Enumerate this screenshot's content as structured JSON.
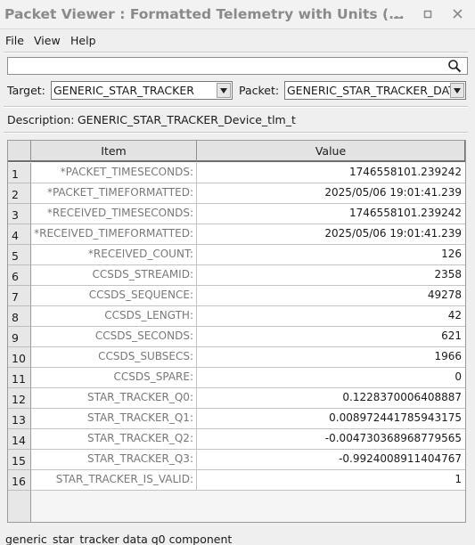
{
  "window": {
    "title": "Packet Viewer : Formatted Telemetry with Units (...",
    "minimize_glyph": "−",
    "maximize_glyph": "□",
    "close_glyph": "✕"
  },
  "menu": {
    "file": "File",
    "view": "View",
    "help": "Help"
  },
  "search": {
    "value": "",
    "icon": "search-icon"
  },
  "target": {
    "label": "Target:",
    "value": "GENERIC_STAR_TRACKER"
  },
  "packet": {
    "label": "Packet:",
    "value": "GENERIC_STAR_TRACKER_DATA"
  },
  "description": {
    "label": "Description:",
    "value": "GENERIC_STAR_TRACKER_Device_tlm_t"
  },
  "table": {
    "headers": {
      "item": "Item",
      "value": "Value"
    },
    "rows": [
      {
        "num": "1",
        "item": "*PACKET_TIMESECONDS:",
        "value": "1746558101.239242"
      },
      {
        "num": "2",
        "item": "*PACKET_TIMEFORMATTED:",
        "value": "2025/05/06 19:01:41.239"
      },
      {
        "num": "3",
        "item": "*RECEIVED_TIMESECONDS:",
        "value": "1746558101.239242"
      },
      {
        "num": "4",
        "item": "*RECEIVED_TIMEFORMATTED:",
        "value": "2025/05/06 19:01:41.239"
      },
      {
        "num": "5",
        "item": "*RECEIVED_COUNT:",
        "value": "126"
      },
      {
        "num": "6",
        "item": "CCSDS_STREAMID:",
        "value": "2358"
      },
      {
        "num": "7",
        "item": "CCSDS_SEQUENCE:",
        "value": "49278"
      },
      {
        "num": "8",
        "item": "CCSDS_LENGTH:",
        "value": "42"
      },
      {
        "num": "9",
        "item": "CCSDS_SECONDS:",
        "value": "621"
      },
      {
        "num": "10",
        "item": "CCSDS_SUBSECS:",
        "value": "1966"
      },
      {
        "num": "11",
        "item": "CCSDS_SPARE:",
        "value": "0"
      },
      {
        "num": "12",
        "item": "STAR_TRACKER_Q0:",
        "value": "0.1228370006408887"
      },
      {
        "num": "13",
        "item": "STAR_TRACKER_Q1:",
        "value": "0.008972441785943175"
      },
      {
        "num": "14",
        "item": "STAR_TRACKER_Q2:",
        "value": "-0.004730368968779565"
      },
      {
        "num": "15",
        "item": "STAR_TRACKER_Q3:",
        "value": "-0.9924008911404767"
      },
      {
        "num": "16",
        "item": "STAR_TRACKER_IS_VALID:",
        "value": "1"
      }
    ]
  },
  "status_bar": {
    "text": "generic_star_tracker data q0 component"
  }
}
